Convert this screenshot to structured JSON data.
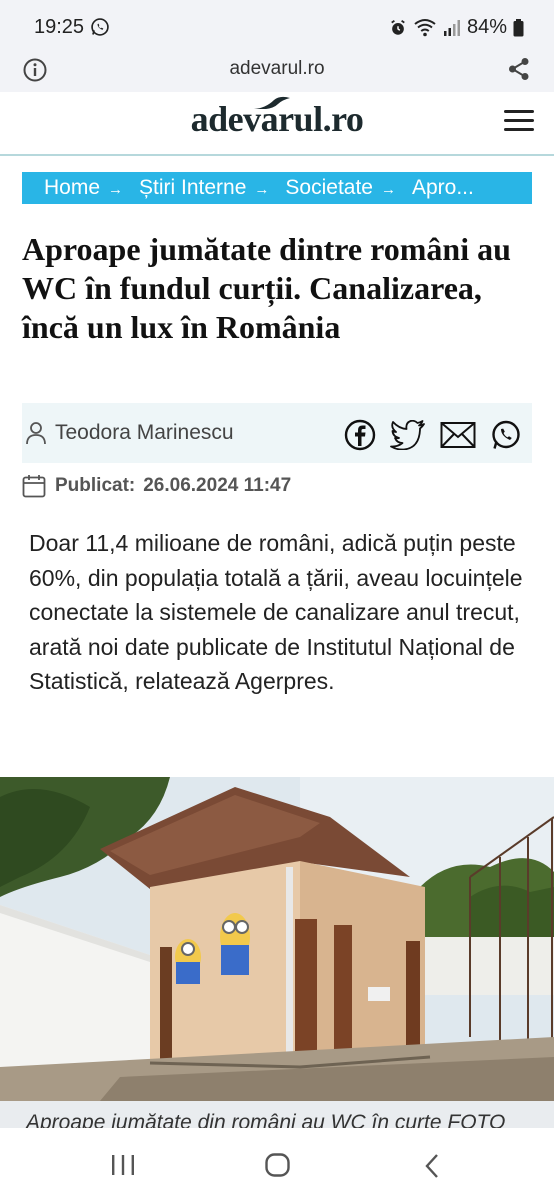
{
  "status": {
    "time": "19:25",
    "battery": "84%"
  },
  "browser": {
    "url": "adevarul.ro"
  },
  "site": {
    "logo": "adevarul.ro"
  },
  "breadcrumb": {
    "items": [
      {
        "label": "Home"
      },
      {
        "label": "Știri Interne"
      },
      {
        "label": "Societate"
      },
      {
        "label": "Apro..."
      }
    ],
    "separator": "→"
  },
  "article": {
    "title": "Aproape jumătate dintre români au WC în fundul curții. Canalizarea, încă un lux în România",
    "author": "Teodora Marinescu",
    "published_label": "Publicat:",
    "published_date": "26.06.2024 11:47",
    "lead": "Doar 11,4 milioane de români, adică puțin peste 60%, din populația totală a țării, aveau locuințele conectate la sistemele de canalizare anul trecut, arată noi date publicate de Institutul Național de Statistică, relatează Agerpres.",
    "image_caption": "Aproape jumătate din români au WC în curte FOTO"
  },
  "icons": {
    "status": [
      "whatsapp-icon",
      "alarm-icon",
      "wifi-icon",
      "signal-icon",
      "battery-icon"
    ],
    "social": [
      "facebook-icon",
      "twitter-icon",
      "email-icon",
      "whatsapp-icon"
    ]
  },
  "colors": {
    "breadcrumb_bg": "#29b5e6",
    "author_box_bg": "#eef6f8",
    "header_border": "#b6d8dc"
  }
}
